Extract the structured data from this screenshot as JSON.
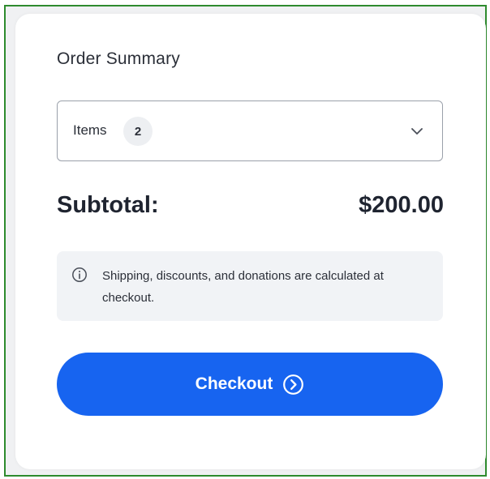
{
  "order_summary": {
    "title": "Order Summary",
    "items_select": {
      "label": "Items",
      "count": "2"
    },
    "subtotal": {
      "label": "Subtotal:",
      "value": "$200.00"
    },
    "notice": {
      "text": "Shipping, discounts, and donations are calculated at checkout."
    },
    "checkout_button": {
      "label": "Checkout"
    }
  },
  "icons": {
    "items_chevron": "chevron-down-icon",
    "notice_info": "info-icon",
    "checkout_arrow": "arrow-right-circle-icon"
  },
  "colors": {
    "primary_button": "#1764f0",
    "frame_border": "#2e8b2e",
    "notice_bg": "#f1f3f6",
    "text_dark": "#1f2430"
  }
}
